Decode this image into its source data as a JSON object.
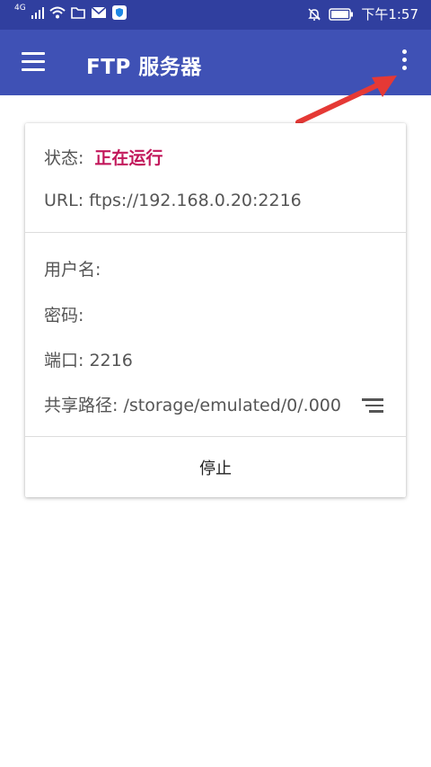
{
  "status_bar": {
    "signal_label": "4G",
    "time": "下午1:57",
    "icons": [
      "signal-icon",
      "wifi-icon",
      "folder-icon",
      "mail-icon",
      "shield-icon",
      "mute-icon",
      "battery-icon"
    ]
  },
  "app_bar": {
    "title": "FTP 服务器",
    "color": "#3f51b5",
    "status_color": "#303f9f"
  },
  "annotation": {
    "arrow_color": "#e53935",
    "points_to": "overflow-menu-button"
  },
  "card": {
    "status_label": "状态:",
    "status_value": "正在运行",
    "status_color": "#c2185b",
    "url_text": "URL: ftps://192.168.0.20:2216",
    "username_label": "用户名:",
    "password_label": "密码:",
    "port_text": "端口: 2216",
    "share_path_text": "共享路径: /storage/emulated/0/.000",
    "stop_label": "停止"
  }
}
